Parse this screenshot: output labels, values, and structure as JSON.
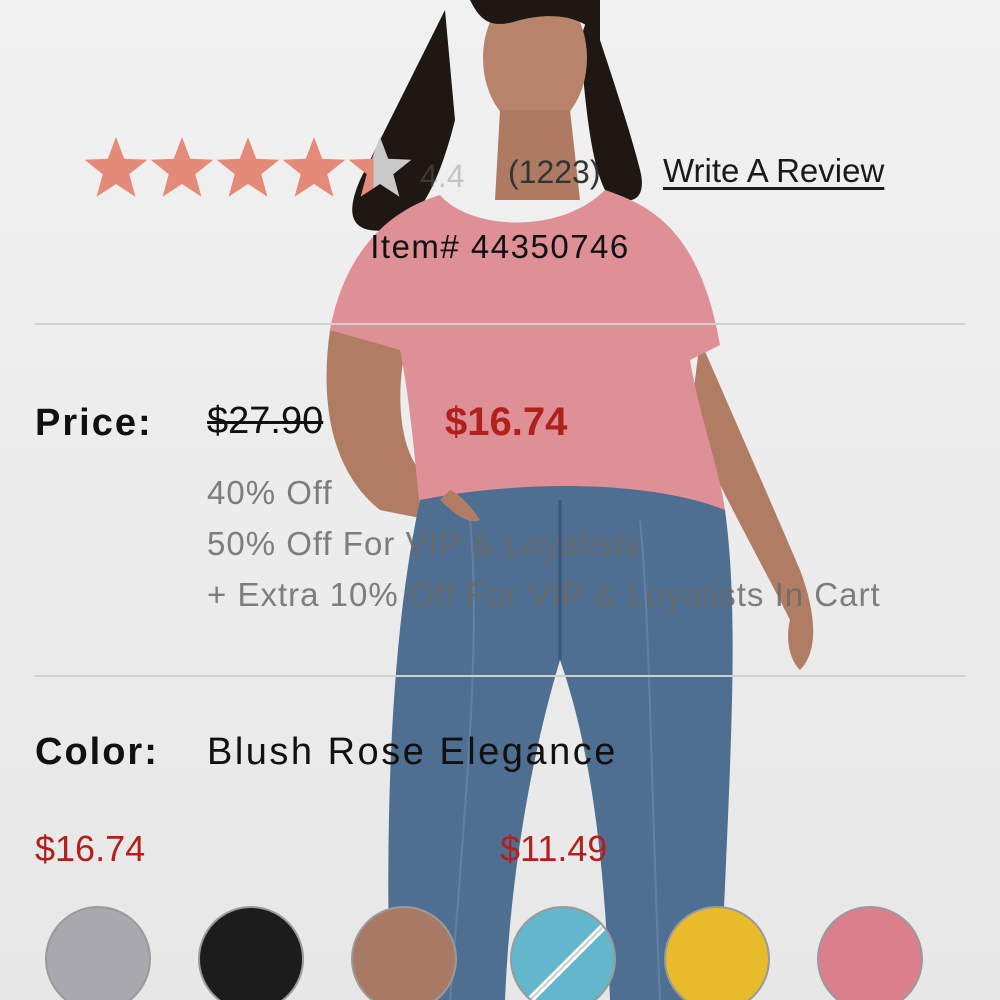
{
  "rating": {
    "stars_filled": 4.4,
    "stars_total": 5,
    "value_text": "4.4",
    "count_text": "(1223)",
    "write_review_label": "Write A Review",
    "star_color": "#e48a78",
    "star_empty_color": "#c9c9c9"
  },
  "item": {
    "number_text": "Item# 44350746"
  },
  "price": {
    "label": "Price:",
    "original": "$27.90",
    "sale": "$16.74",
    "promos": [
      "40% Off",
      "50% Off For VIP & Loyalists",
      "+ Extra 10% Off For VIP & Loyalists In Cart"
    ]
  },
  "color": {
    "label": "Color:",
    "selected": "Blush Rose Elegance",
    "swatch_prices": [
      "$16.74",
      "$11.49"
    ],
    "swatches": [
      {
        "name": "heather-grey-swatch",
        "hex": "#a8a8ae",
        "unavailable": false
      },
      {
        "name": "black-swatch",
        "hex": "#1c1c1c",
        "unavailable": false
      },
      {
        "name": "mocha-swatch",
        "hex": "#a87a66",
        "unavailable": false
      },
      {
        "name": "aqua-swatch",
        "hex": "#62b7cc",
        "unavailable": true
      },
      {
        "name": "mustard-swatch",
        "hex": "#e8bb2a",
        "unavailable": false
      },
      {
        "name": "blush-rose-swatch",
        "hex": "#db7f8d",
        "unavailable": false
      }
    ]
  }
}
